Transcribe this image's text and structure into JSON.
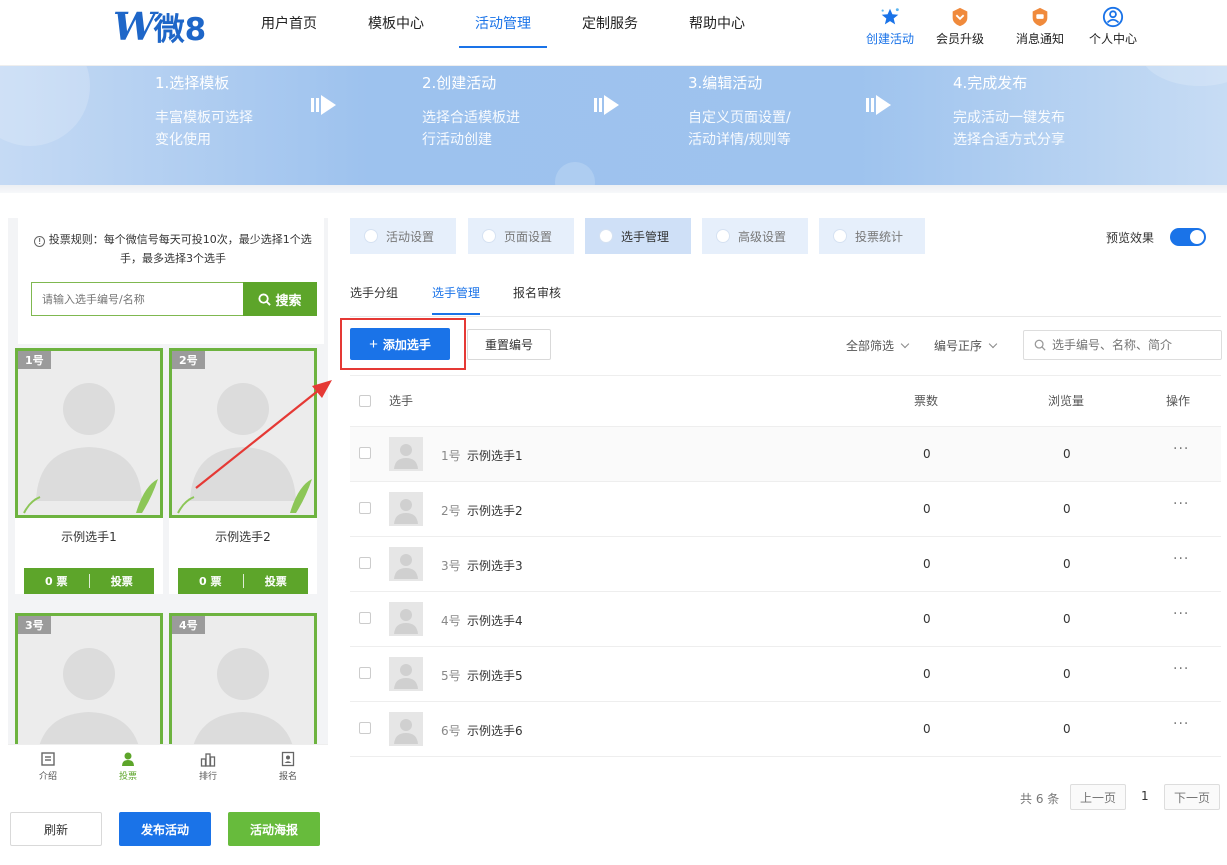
{
  "brand": {
    "logo_letter": "W",
    "logo_text": "微8"
  },
  "nav": [
    {
      "label": "用户首页"
    },
    {
      "label": "模板中心"
    },
    {
      "label": "活动管理",
      "active": true
    },
    {
      "label": "定制服务"
    },
    {
      "label": "帮助中心"
    }
  ],
  "header_tools": [
    {
      "label": "创建活动",
      "icon": "star-create-icon"
    },
    {
      "label": "会员升级",
      "icon": "vip-badge-icon"
    },
    {
      "label": "消息通知",
      "icon": "message-badge-icon"
    },
    {
      "label": "个人中心",
      "icon": "user-circle-icon"
    }
  ],
  "steps": [
    {
      "title": "1.选择模板",
      "line1": "丰富模板可选择",
      "line2": "变化使用"
    },
    {
      "title": "2.创建活动",
      "line1": "选择合适模板进",
      "line2": "行活动创建"
    },
    {
      "title": "3.编辑活动",
      "line1": "自定义页面设置/",
      "line2": "活动详情/规则等"
    },
    {
      "title": "4.完成发布",
      "line1": "完成活动一键发布",
      "line2": "选择合适方式分享"
    }
  ],
  "preview": {
    "rule_line1": "投票规则：每个微信号每天可投10次，最少选择1个选",
    "rule_line2": "手，最多选择3个选手",
    "search_placeholder": "请输入选手编号/名称",
    "search_button": "搜索",
    "cards": [
      {
        "num": "1号",
        "name": "示例选手1",
        "votes": "0 票",
        "vote_label": "投票"
      },
      {
        "num": "2号",
        "name": "示例选手2",
        "votes": "0 票",
        "vote_label": "投票"
      },
      {
        "num": "3号"
      },
      {
        "num": "4号"
      }
    ],
    "tabbar": [
      {
        "label": "介绍",
        "icon": "intro-icon"
      },
      {
        "label": "投票",
        "icon": "person-icon",
        "active": true
      },
      {
        "label": "排行",
        "icon": "ranking-icon"
      },
      {
        "label": "报名",
        "icon": "signup-icon"
      }
    ]
  },
  "bottom_buttons": {
    "refresh": "刷新",
    "publish": "发布活动",
    "poster": "活动海报"
  },
  "settings_tabs": [
    {
      "label": "活动设置"
    },
    {
      "label": "页面设置"
    },
    {
      "label": "选手管理",
      "active": true
    },
    {
      "label": "高级设置"
    },
    {
      "label": "投票统计"
    }
  ],
  "preview_toggle": {
    "label": "预览效果",
    "on": true
  },
  "sub_tabs": [
    {
      "label": "选手分组"
    },
    {
      "label": "选手管理",
      "active": true
    },
    {
      "label": "报名审核"
    }
  ],
  "toolbar": {
    "add": "添加选手",
    "add_prefix": "+",
    "reset": "重置编号",
    "filter_all": "全部筛选",
    "sort_num": "编号正序",
    "search_placeholder": "选手编号、名称、简介"
  },
  "table": {
    "headers": {
      "player": "选手",
      "votes": "票数",
      "views": "浏览量",
      "ops": "操作"
    },
    "rows": [
      {
        "num": "1号",
        "name": "示例选手1",
        "votes": "0",
        "views": "0",
        "more": "···"
      },
      {
        "num": "2号",
        "name": "示例选手2",
        "votes": "0",
        "views": "0",
        "more": "···"
      },
      {
        "num": "3号",
        "name": "示例选手3",
        "votes": "0",
        "views": "0",
        "more": "···"
      },
      {
        "num": "4号",
        "name": "示例选手4",
        "votes": "0",
        "views": "0",
        "more": "···"
      },
      {
        "num": "5号",
        "name": "示例选手5",
        "votes": "0",
        "views": "0",
        "more": "···"
      },
      {
        "num": "6号",
        "name": "示例选手6",
        "votes": "0",
        "views": "0",
        "more": "···"
      }
    ]
  },
  "pagination": {
    "total": "共 6 条",
    "prev": "上一页",
    "page": "1",
    "next": "下一页"
  },
  "colors": {
    "accent": "#1a73e8",
    "green": "#5da52a",
    "highlight": "#e53935"
  }
}
